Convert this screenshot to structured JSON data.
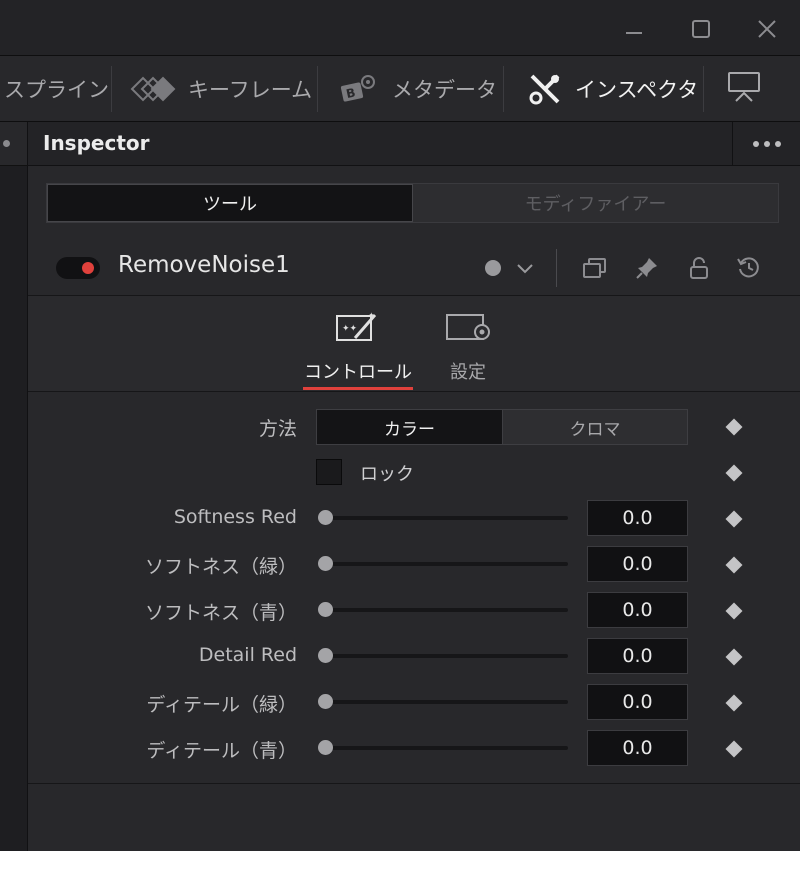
{
  "window": {
    "controls": [
      "minimize-icon",
      "maximize-icon",
      "close-icon"
    ]
  },
  "toolbar": {
    "items": [
      {
        "label": "スプライン",
        "icon": "spline-icon",
        "active": false
      },
      {
        "label": "キーフレーム",
        "icon": "keyframes-icon",
        "active": false
      },
      {
        "label": "メタデータ",
        "icon": "metadata-icon",
        "active": false
      },
      {
        "label": "インスペクタ",
        "icon": "inspector-icon",
        "active": true
      },
      {
        "label": "",
        "icon": "presentation-icon",
        "active": false
      }
    ]
  },
  "inspector": {
    "title": "Inspector",
    "tabs": {
      "tools": "ツール",
      "modifiers": "モディファイアー"
    },
    "tool": {
      "name": "RemoveNoise1",
      "enabled": true,
      "accent": "#e0413c",
      "icons": [
        "color-dot-icon",
        "chevron-down-icon",
        "versions-icon",
        "pin-icon",
        "lock-icon",
        "reset-icon"
      ]
    },
    "subtabs": {
      "controls": "コントロール",
      "settings": "設定",
      "active": "controls"
    },
    "method": {
      "label": "方法",
      "options": [
        "カラー",
        "クロマ"
      ],
      "selected": "カラー"
    },
    "lock": {
      "label": "ロック",
      "checked": false
    },
    "sliders": [
      {
        "label": "Softness Red",
        "value": "0.0"
      },
      {
        "label": "ソフトネス（緑）",
        "value": "0.0"
      },
      {
        "label": "ソフトネス（青）",
        "value": "0.0"
      },
      {
        "label": "Detail Red",
        "value": "0.0"
      },
      {
        "label": "ディテール（緑）",
        "value": "0.0"
      },
      {
        "label": "ディテール（青）",
        "value": "0.0"
      }
    ]
  }
}
